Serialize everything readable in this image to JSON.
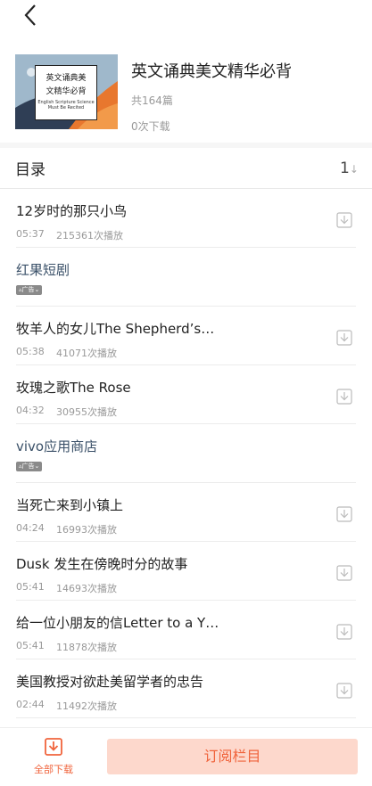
{
  "header": {
    "back_icon": "chevron-left-icon"
  },
  "album": {
    "cover_title_line1": "英文诵典美",
    "cover_title_line2": "文精华必背",
    "cover_subtitle_line1": "English Scripture Science",
    "cover_subtitle_line2": "Must Be Recited",
    "title": "英文诵典美文精华必背",
    "episode_count": "共164篇",
    "download_count": "0次下载"
  },
  "toc": {
    "label": "目录",
    "sort_label": "1",
    "sort_arrow": "↓"
  },
  "items": [
    {
      "name": "12岁时的那只小鸟",
      "duration": "05:37",
      "plays": "215361次播放"
    },
    {
      "name": "红果短剧",
      "ad": "广告"
    },
    {
      "name": "牧羊人的女儿The Shepherd’s…",
      "duration": "05:38",
      "plays": "41071次播放"
    },
    {
      "name": "玫瑰之歌The Rose",
      "duration": "04:32",
      "plays": "30955次播放"
    },
    {
      "name": "vivo应用商店",
      "ad": "广告"
    },
    {
      "name": "当死亡来到小镇上",
      "duration": "04:24",
      "plays": "16993次播放"
    },
    {
      "name": "Dusk 发生在傍晚时分的故事",
      "duration": "05:41",
      "plays": "14693次播放"
    },
    {
      "name": "给一位小朋友的信Letter to a Y…",
      "duration": "05:41",
      "plays": "11878次播放"
    },
    {
      "name": "美国教授对欲赴美留学者的忠告",
      "duration": "02:44",
      "plays": "11492次播放"
    }
  ],
  "bottom": {
    "download_all_label": "全部下载",
    "subscribe_label": "订阅栏目",
    "accent_color": "#f0643c"
  }
}
